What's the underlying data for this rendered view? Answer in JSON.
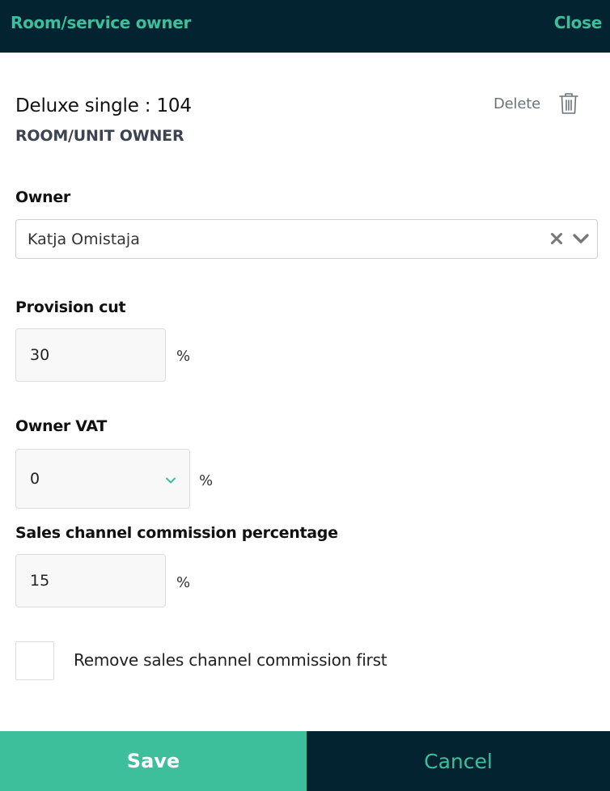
{
  "header": {
    "title": "Room/service owner",
    "close_label": "Close"
  },
  "room": {
    "title": "Deluxe single : 104",
    "subtitle": "ROOM/UNIT OWNER",
    "delete_label": "Delete"
  },
  "owner": {
    "label": "Owner",
    "value": "Katja Omistaja"
  },
  "provision": {
    "label": "Provision cut",
    "value": "30",
    "unit": "%"
  },
  "vat": {
    "label": "Owner VAT",
    "value": "0",
    "unit": "%"
  },
  "commission": {
    "label": "Sales channel commission percentage",
    "value": "15",
    "unit": "%"
  },
  "remove_commission": {
    "label": "Remove sales channel commission first",
    "checked": false
  },
  "footer": {
    "save_label": "Save",
    "cancel_label": "Cancel"
  },
  "colors": {
    "accent": "#3dbf9c",
    "header_bg": "#032330",
    "subtitle": "#3d4350"
  },
  "icons": {
    "delete": "trash-icon",
    "clear": "clear-icon",
    "dropdown": "chevron-down-icon"
  }
}
